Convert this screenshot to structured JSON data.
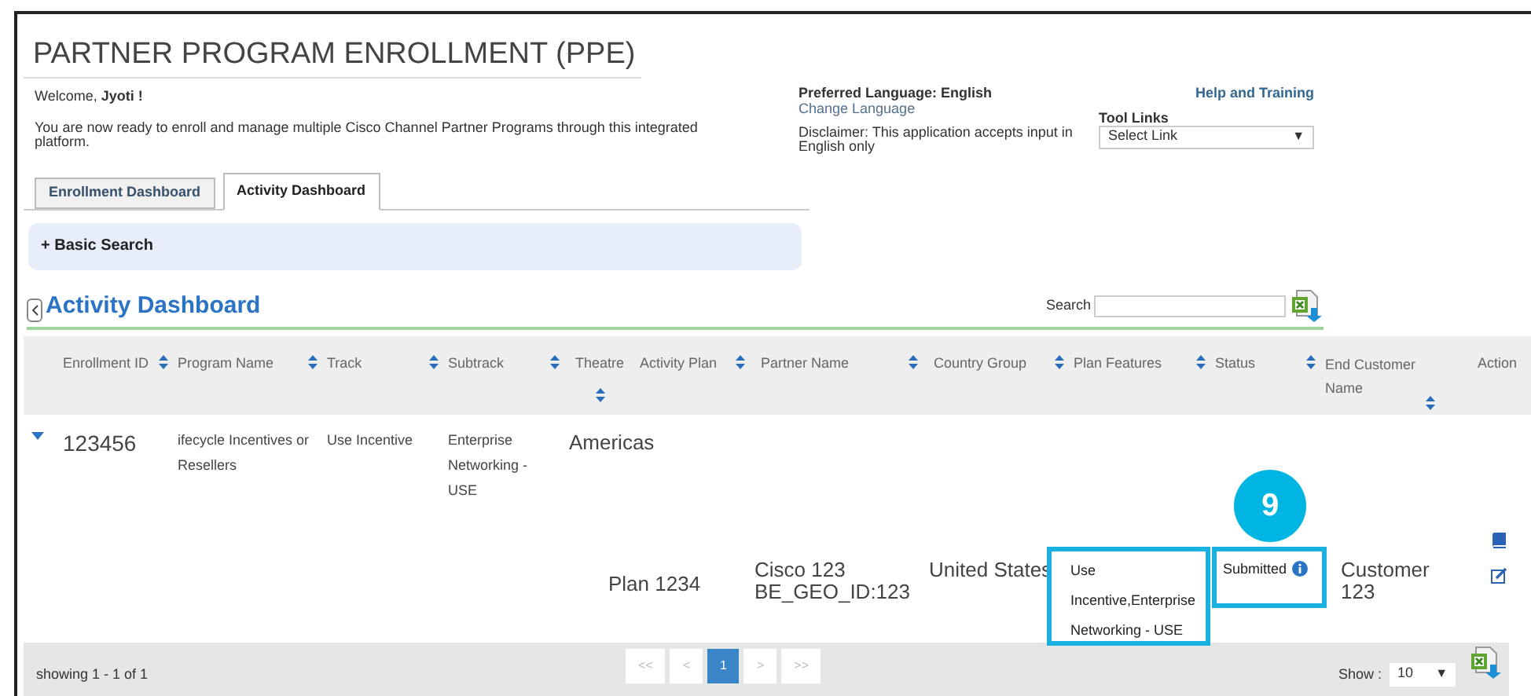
{
  "page_title": "PARTNER PROGRAM ENROLLMENT (PPE)",
  "welcome": {
    "prefix": "Welcome,",
    "user": "Jyoti !"
  },
  "intro": "You are now ready to enroll and manage multiple   Cisco Channel Partner Programs through this integrated platform.",
  "language": {
    "preferred": "Preferred Language: English",
    "change_link": "Change Language",
    "disclaimer": "Disclaimer: This application accepts input in English only"
  },
  "help_link": "Help and Training",
  "tool_links": {
    "label": "Tool Links",
    "value": "Select Link",
    "arrow": "▼"
  },
  "tabs": [
    {
      "label": "Enrollment Dashboard",
      "selected": false
    },
    {
      "label": "Activity Dashboard",
      "selected": true
    }
  ],
  "basic_search": {
    "icon": "+",
    "label": "Basic Search",
    "expanded": false
  },
  "section_title": "Activity Dashboard",
  "search": {
    "label": "Search"
  },
  "table": {
    "columns": [
      {
        "label": "Enrollment ID",
        "sortable": true
      },
      {
        "label": "Program Name",
        "sortable": true
      },
      {
        "label": "Track",
        "sortable": true
      },
      {
        "label": "Subtrack",
        "sortable": true
      },
      {
        "label": "Theatre",
        "sortable": true
      },
      {
        "label": "Activity Plan",
        "sortable": true
      },
      {
        "label": "Partner Name",
        "sortable": true
      },
      {
        "label": "Country Group",
        "sortable": true
      },
      {
        "label": "Plan Features",
        "sortable": true
      },
      {
        "label": "Status",
        "sortable": true
      },
      {
        "label": "End Customer Name",
        "sortable": true
      },
      {
        "label": "Action",
        "sortable": false
      }
    ],
    "rows": [
      {
        "expanded": true,
        "enrollment_id": "123456",
        "program_name": "ifecycle Incentives or Resellers",
        "track": "Use Incentive",
        "subtrack": "Enterprise Networking - USE",
        "theatre": "Americas",
        "activity_plan": "Plan 1234",
        "partner_name": "Cisco 123 BE_GEO_ID:123",
        "country_group": "United States",
        "plan_features": {
          "text": "Use Incentive,Enterprise Networking - USE",
          "highlighted": true
        },
        "status": {
          "text": "Submitted",
          "highlighted": true,
          "callout": "9"
        },
        "end_customer_name": "Customer 123"
      }
    ]
  },
  "footer": {
    "showing": "showing 1 - 1 of 1",
    "pages": [
      {
        "label": "<<",
        "selected": false,
        "disabled": true
      },
      {
        "label": "<",
        "selected": false,
        "disabled": true
      },
      {
        "label": "1",
        "selected": true,
        "disabled": false
      },
      {
        "label": ">",
        "selected": false,
        "disabled": true
      },
      {
        "label": ">>",
        "selected": false,
        "disabled": true
      }
    ],
    "show_label": "Show :",
    "page_size": "10",
    "arrow": "▼"
  }
}
